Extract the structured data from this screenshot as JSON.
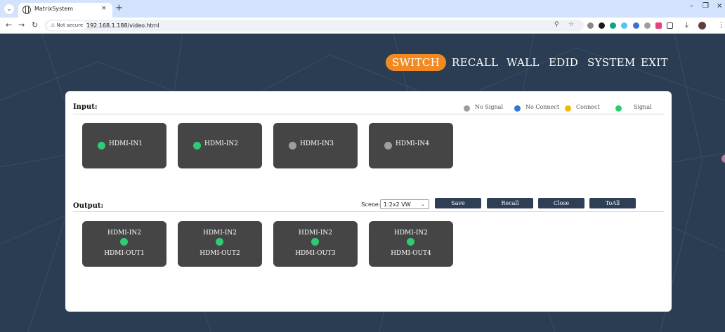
{
  "browser": {
    "tab_title": "MatrixSystem",
    "tab_close": "×",
    "new_tab": "+",
    "security_label": "Not secure",
    "url": "192.168.1.188/video.html",
    "window_controls": [
      "–",
      "❐",
      "×"
    ]
  },
  "nav": {
    "items": [
      {
        "label": "SWITCH",
        "active": true
      },
      {
        "label": "RECALL",
        "active": false
      },
      {
        "label": "WALL",
        "active": false
      },
      {
        "label": "EDID",
        "active": false
      },
      {
        "label": "SYSTEM",
        "active": false
      },
      {
        "label": "EXIT",
        "active": false
      }
    ]
  },
  "input": {
    "title": "Input:",
    "legend": [
      {
        "label": "No Signal",
        "color": "#9e9e9e"
      },
      {
        "label": "No Connect",
        "color": "#2a7bd4"
      },
      {
        "label": "Connect",
        "color": "#f5b800"
      },
      {
        "label": "Signal",
        "color": "#2ecc71"
      }
    ],
    "ports": [
      {
        "label": "HDMI-IN1",
        "status_color": "#2ecc71"
      },
      {
        "label": "HDMI-IN2",
        "status_color": "#2ecc71"
      },
      {
        "label": "HDMI-IN3",
        "status_color": "#9e9e9e"
      },
      {
        "label": "HDMI-IN4",
        "status_color": "#9e9e9e"
      }
    ]
  },
  "output": {
    "title": "Output:",
    "scene_label": "Scene:",
    "scene_value": "1:2x2 VW",
    "buttons": {
      "save": "Save",
      "recall": "Recall",
      "close": "Close",
      "toall": "ToAll"
    },
    "ports": [
      {
        "source": "HDMI-IN2",
        "name": "HDMI-OUT1",
        "status_color": "#2ecc71"
      },
      {
        "source": "HDMI-IN2",
        "name": "HDMI-OUT2",
        "status_color": "#2ecc71"
      },
      {
        "source": "HDMI-IN2",
        "name": "HDMI-OUT3",
        "status_color": "#2ecc71"
      },
      {
        "source": "HDMI-IN2",
        "name": "HDMI-OUT4",
        "status_color": "#2ecc71"
      }
    ]
  },
  "colors": {
    "accent": "#f28a21",
    "page_background": "#2b3d52",
    "card": "#454545",
    "button": "#2d3e55"
  }
}
